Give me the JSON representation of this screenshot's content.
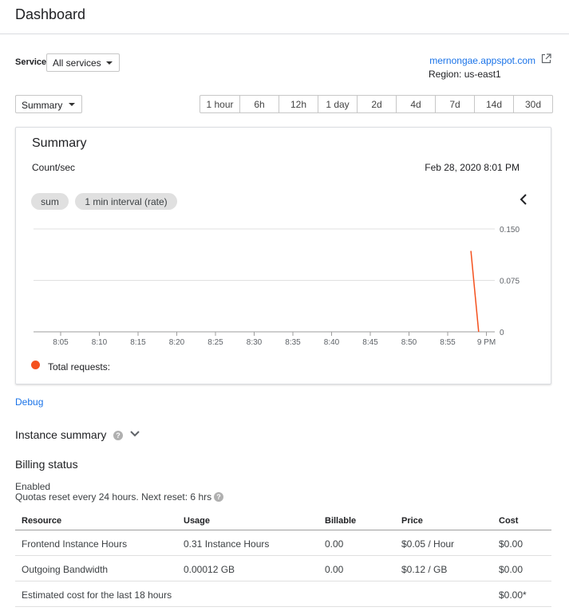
{
  "header": {
    "title": "Dashboard"
  },
  "service": {
    "label": "Service",
    "selected": "All services"
  },
  "app": {
    "link": "mernongae.appspot.com",
    "region": "Region: us-east1"
  },
  "view_select": {
    "selected": "Summary"
  },
  "time_ranges": [
    "1 hour",
    "6h",
    "12h",
    "1 day",
    "2d",
    "4d",
    "7d",
    "14d",
    "30d"
  ],
  "card": {
    "title": "Summary",
    "unit": "Count/sec",
    "date": "Feb 28, 2020 8:01 PM",
    "chips": [
      "sum",
      "1 min interval (rate)"
    ]
  },
  "chart_data": {
    "type": "line",
    "x_tick_labels": [
      "8:05",
      "8:10",
      "8:15",
      "8:20",
      "8:25",
      "8:30",
      "8:35",
      "8:40",
      "8:45",
      "8:50",
      "8:55",
      "9 PM"
    ],
    "y_tick_labels": [
      "0.150",
      "0.075",
      "0"
    ],
    "ylim": [
      0,
      0.15
    ],
    "grid": true,
    "series": [
      {
        "name": "Total requests:",
        "color": "#f4511e",
        "points": [
          {
            "x": "8:58",
            "y": 0.118
          },
          {
            "x": "8:59",
            "y": 0
          }
        ]
      }
    ],
    "legend_position": "bottom-left"
  },
  "debug_link": "Debug",
  "instance_summary": {
    "title": "Instance summary"
  },
  "billing": {
    "title": "Billing status",
    "status": "Enabled",
    "quota_text": "Quotas reset every 24 hours. Next reset: 6 hrs"
  },
  "table": {
    "headers": [
      "Resource",
      "Usage",
      "Billable",
      "Price",
      "Cost"
    ],
    "rows": [
      [
        "Frontend Instance Hours",
        "0.31 Instance Hours",
        "0.00",
        "$0.05 / Hour",
        "$0.00"
      ],
      [
        "Outgoing Bandwidth",
        "0.00012 GB",
        "0.00",
        "$0.12 / GB",
        "$0.00"
      ],
      [
        "Estimated cost for the last 18 hours",
        "",
        "",
        "",
        "$0.00*"
      ]
    ]
  }
}
